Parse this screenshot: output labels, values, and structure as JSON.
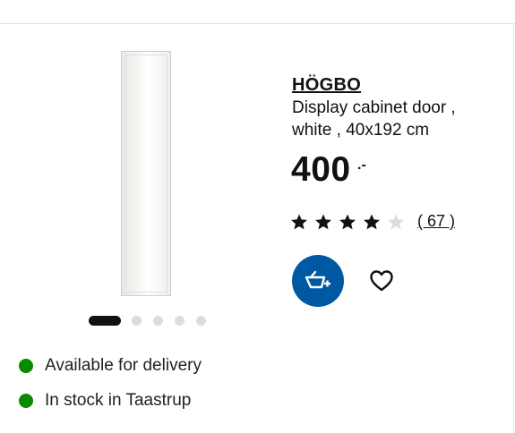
{
  "product": {
    "name": "HÖGBO",
    "description": "Display cabinet door , white , 40x192 cm",
    "price": "400",
    "price_suffix": ".-",
    "rating": 4,
    "rating_max": 5,
    "reviews_label": "( 67 )",
    "image_icon": "cabinet-door-image"
  },
  "carousel": {
    "total": 5,
    "active": 1
  },
  "actions": {
    "cart_icon": "add-to-cart-icon",
    "favourite_icon": "heart-icon"
  },
  "availability": [
    {
      "text": "Available for delivery",
      "status_color": "#0a8a00"
    },
    {
      "text": "In stock in Taastrup",
      "status_color": "#0a8a00"
    }
  ],
  "colors": {
    "accent": "#0058a3",
    "status_green": "#0a8a00"
  }
}
